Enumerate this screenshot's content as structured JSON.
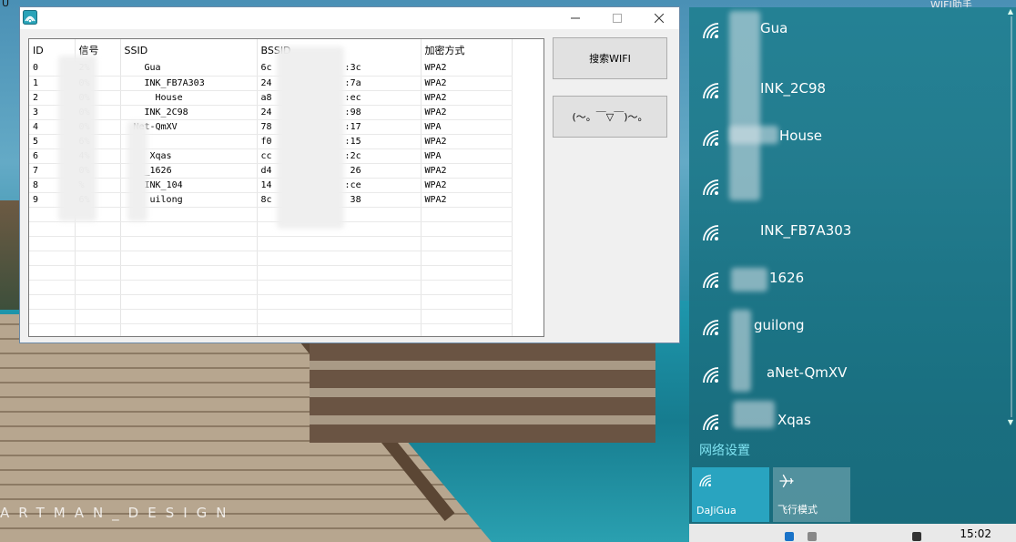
{
  "desktop": {
    "watermark": "ARTMAN_DESIGN",
    "top_text_left": "U",
    "top_text_right": "WIFI助手"
  },
  "window": {
    "columns": [
      "ID",
      "信号",
      "SSID",
      "BSSID",
      "加密方式"
    ],
    "rows": [
      {
        "id": "0",
        "signal": "2%",
        "ssid": "Gua",
        "bssid": "6c",
        "bssid_tail": ":3c",
        "auth": "WPA2"
      },
      {
        "id": "1",
        "signal": "0%",
        "ssid": "INK_FB7A303",
        "bssid": "24",
        "bssid_tail": ":7a",
        "auth": "WPA2"
      },
      {
        "id": "2",
        "signal": "0%",
        "ssid": "House",
        "bssid": "a8",
        "bssid_tail": ":ec",
        "auth": "WPA2"
      },
      {
        "id": "3",
        "signal": "0%",
        "ssid": "INK_2C98",
        "bssid": "24",
        "bssid_tail": ":98",
        "auth": "WPA2"
      },
      {
        "id": "4",
        "signal": "0%",
        "ssid": "Net-QmXV",
        "bssid": "78",
        "bssid_tail": ":17",
        "auth": "WPA"
      },
      {
        "id": "5",
        "signal": "6%",
        "ssid": "",
        "bssid": "f0",
        "bssid_tail": ":15",
        "auth": "WPA2"
      },
      {
        "id": "6",
        "signal": "4%",
        "ssid": "Xqas",
        "bssid": "cc",
        "bssid_tail": ":2c",
        "auth": "WPA"
      },
      {
        "id": "7",
        "signal": "0%",
        "ssid": "_1626",
        "bssid": "d4",
        "bssid_tail": "26",
        "auth": "WPA2"
      },
      {
        "id": "8",
        "signal": "%",
        "ssid": "INK_104",
        "bssid": "14",
        "bssid_tail": ":ce",
        "auth": "WPA2"
      },
      {
        "id": "9",
        "signal": "6%",
        "ssid": "uilong",
        "bssid": "8c",
        "bssid_tail": "38",
        "auth": "WPA2"
      }
    ],
    "search_button": "搜索WIFI",
    "face_button": "(～。￣▽￣)～。"
  },
  "flyout": {
    "networks": [
      "Gua",
      "INK_2C98",
      "House",
      "",
      "INK_FB7A303",
      "1626",
      "guilong",
      "aNet-QmXV",
      "Xqas"
    ],
    "network_settings": "网络设置",
    "tiles": [
      {
        "label": "DaJiGua"
      },
      {
        "label": "飞行模式"
      }
    ]
  },
  "taskbar": {
    "clock": "15:02"
  },
  "colors": {
    "flyout_bg": "#1f7f91",
    "accent_tile": "#29a4c0",
    "settings_link": "#7fe3f1"
  }
}
